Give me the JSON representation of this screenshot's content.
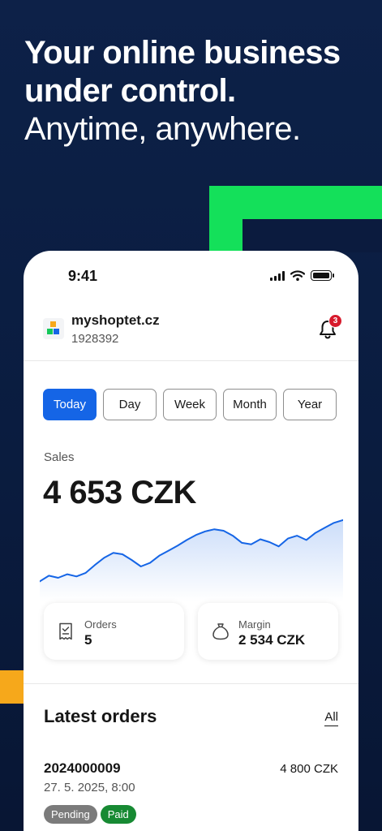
{
  "hero": {
    "line1": "Your online business",
    "line2": "under control.",
    "line3": "Anytime, anywhere."
  },
  "status_bar": {
    "time": "9:41",
    "icons": [
      "signal-icon",
      "wifi-icon",
      "battery-icon"
    ]
  },
  "shop": {
    "name": "myshoptet.cz",
    "id": "1928392",
    "notifications_count": "3",
    "logo_colors": [
      "#f6a81b",
      "#14c85a",
      "#1565e6"
    ]
  },
  "period_tabs": [
    {
      "label": "Today",
      "active": true
    },
    {
      "label": "Day",
      "active": false
    },
    {
      "label": "Week",
      "active": false
    },
    {
      "label": "Month",
      "active": false
    },
    {
      "label": "Year",
      "active": false
    }
  ],
  "sales": {
    "label": "Sales",
    "value": "4 653 CZK"
  },
  "chart_data": {
    "type": "area",
    "values": [
      12,
      20,
      17,
      22,
      19,
      24,
      35,
      45,
      52,
      50,
      42,
      33,
      38,
      48,
      55,
      62,
      70,
      77,
      82,
      85,
      83,
      76,
      66,
      64,
      71,
      67,
      61,
      72,
      76,
      70,
      80,
      87,
      94,
      98
    ]
  },
  "stats": {
    "orders": {
      "label": "Orders",
      "value": "5",
      "icon": "receipt-icon"
    },
    "margin": {
      "label": "Margin",
      "value": "2 534 CZK",
      "icon": "money-bag-icon"
    }
  },
  "latest_orders": {
    "title": "Latest orders",
    "all_label": "All",
    "items": [
      {
        "id": "2024000009",
        "amount": "4 800 CZK",
        "date": "27. 5. 2025, 8:00",
        "badges": [
          "Pending",
          "Paid"
        ]
      }
    ]
  },
  "colors": {
    "accent": "#1565e6",
    "background": "#0d2148",
    "deco_green": "#14e05a",
    "deco_orange": "#f6a81b",
    "badge_pending": "#7b7b7b",
    "badge_paid": "#178a33",
    "notification_badge": "#d71a2c"
  }
}
